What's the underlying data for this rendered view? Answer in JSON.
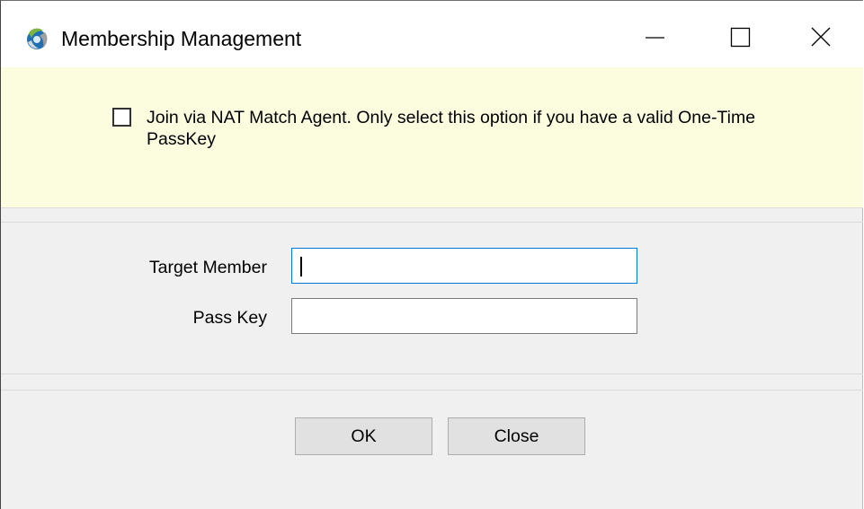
{
  "window": {
    "title": "Membership Management",
    "app_icon": "app-logo-icon",
    "controls": {
      "minimize_icon": "minimize-icon",
      "maximize_icon": "maximize-icon",
      "close_icon": "close-icon"
    }
  },
  "info_panel": {
    "checkbox_checked": false,
    "checkbox_label": "Join via NAT Match Agent. Only select this option if you have a valid One-Time PassKey",
    "background_color": "#fcfcdf"
  },
  "form": {
    "target_member_label": "Target Member",
    "target_member_value": "",
    "pass_key_label": "Pass Key",
    "pass_key_value": ""
  },
  "buttons": {
    "ok_label": "OK",
    "close_label": "Close"
  },
  "colors": {
    "focus_border": "#0078d7",
    "button_face": "#e1e1e1"
  }
}
